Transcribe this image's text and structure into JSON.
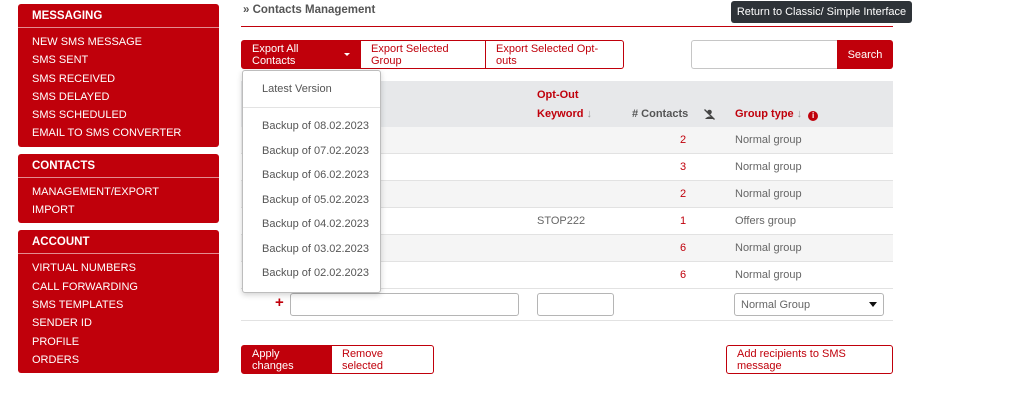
{
  "sidebar": {
    "messaging": {
      "title": "MESSAGING",
      "items": [
        "NEW SMS MESSAGE",
        "SMS SENT",
        "SMS RECEIVED",
        "SMS DELAYED",
        "SMS SCHEDULED",
        "EMAIL TO SMS CONVERTER"
      ]
    },
    "contacts": {
      "title": "CONTACTS",
      "items": [
        "MANAGEMENT/EXPORT",
        "IMPORT"
      ]
    },
    "account": {
      "title": "ACCOUNT",
      "items": [
        "VIRTUAL NUMBERS",
        "CALL FORWARDING",
        "SMS TEMPLATES",
        "SENDER ID",
        "PROFILE",
        "ORDERS"
      ]
    }
  },
  "header": {
    "title": "» Contacts Management",
    "return_label": "Return to Classic/ Simple Interface"
  },
  "toolbar": {
    "export_all": "Export All Contacts",
    "export_group": "Export Selected Group",
    "export_optouts": "Export Selected Opt-outs",
    "search_placeholder": "",
    "search_label": "Search"
  },
  "dropdown": {
    "items": [
      "Latest Version",
      "Backup of 08.02.2023",
      "Backup of 07.02.2023",
      "Backup of 06.02.2023",
      "Backup of 05.02.2023",
      "Backup of 04.02.2023",
      "Backup of 03.02.2023",
      "Backup of 02.02.2023"
    ]
  },
  "table": {
    "headers": {
      "optout_line1": "Opt-Out",
      "optout_line2": "Keyword",
      "contacts": "# Contacts",
      "group_type": "Group type"
    },
    "rows": [
      {
        "keyword": "",
        "count": "2",
        "type": "Normal group"
      },
      {
        "keyword": "",
        "count": "3",
        "type": "Normal group"
      },
      {
        "keyword": "",
        "count": "2",
        "type": "Normal group"
      },
      {
        "keyword": "STOP222",
        "count": "1",
        "type": "Offers group"
      },
      {
        "keyword": "",
        "count": "6",
        "type": "Normal group"
      },
      {
        "keyword": "",
        "count": "6",
        "type": "Normal group"
      }
    ],
    "new_row": {
      "plus": "+",
      "group_select": "Normal Group"
    }
  },
  "actions": {
    "apply": "Apply changes",
    "remove": "Remove selected",
    "add_recipients": "Add recipients to SMS message"
  },
  "colors": {
    "brand": "#c0000b",
    "dark_button": "#2e3338",
    "header_bg": "#e7e8ea"
  }
}
